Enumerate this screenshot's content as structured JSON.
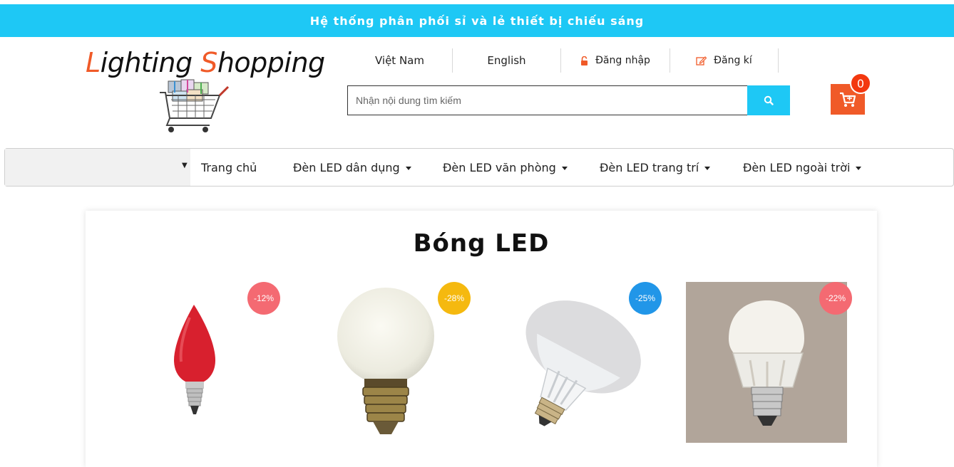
{
  "topbar": {
    "text": "Hệ thống phân phối sỉ và lẻ thiết bị chiếu sáng"
  },
  "logo": {
    "first_letter": "L",
    "part1": "ighting ",
    "second_letter": "S",
    "part2": "hopping"
  },
  "header_links": [
    {
      "label": "Việt Nam"
    },
    {
      "label": "English"
    },
    {
      "label": "Đăng nhập",
      "icon": "lock-icon"
    },
    {
      "label": "Đăng kí",
      "icon": "edit-icon"
    }
  ],
  "search": {
    "placeholder": "Nhận nội dung tìm kiếm",
    "icon": "search-icon"
  },
  "cart": {
    "count": "0",
    "icon": "cart-icon"
  },
  "nav": {
    "items": [
      {
        "label": "Trang chủ",
        "dropdown": false
      },
      {
        "label": "Đèn LED dân dụng",
        "dropdown": true
      },
      {
        "label": "Đèn LED văn phòng",
        "dropdown": true
      },
      {
        "label": "Đèn LED trang trí",
        "dropdown": true
      },
      {
        "label": "Đèn LED ngoài trời",
        "dropdown": true
      }
    ]
  },
  "section": {
    "title": "Bóng LED"
  },
  "products": [
    {
      "discount": "-12%",
      "badge_color": "#f46a72"
    },
    {
      "discount": "-28%",
      "badge_color": "#f5b90f"
    },
    {
      "discount": "-25%",
      "badge_color": "#2196e8"
    },
    {
      "discount": "-22%",
      "badge_color": "#f46a72"
    }
  ],
  "colors": {
    "accent": "#1ec8f5",
    "brand_orange": "#f05a28"
  }
}
